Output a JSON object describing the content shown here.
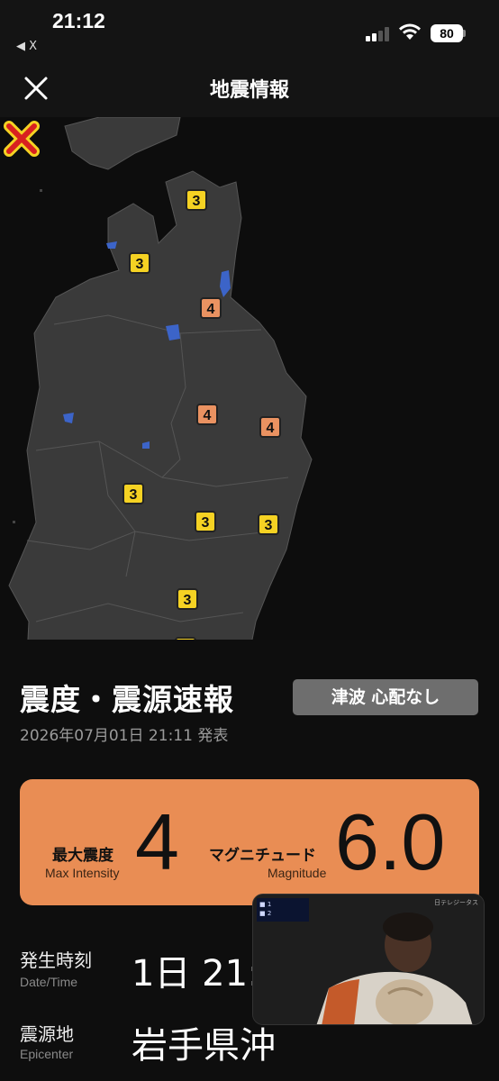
{
  "status_bar": {
    "time": "21:12",
    "back_label": "◀ X",
    "battery": "80"
  },
  "header": {
    "title": "地震情報",
    "close_icon": "close-icon"
  },
  "map": {
    "epicenter_icon": "epicenter-x-icon",
    "intensity_markers": [
      {
        "value": "3",
        "level": 3
      },
      {
        "value": "3",
        "level": 3
      },
      {
        "value": "4",
        "level": 4
      },
      {
        "value": "4",
        "level": 4
      },
      {
        "value": "4",
        "level": 4
      },
      {
        "value": "3",
        "level": 3
      },
      {
        "value": "3",
        "level": 3
      },
      {
        "value": "3",
        "level": 3
      },
      {
        "value": "3",
        "level": 3
      },
      {
        "value": "3",
        "level": 3
      }
    ],
    "colors": {
      "level3": "#f5d223",
      "level4": "#ea9261",
      "land": "#3a3a3a",
      "water": "#3c64c8"
    }
  },
  "report": {
    "title": "震度・震源速報",
    "tsunami_badge": "津波 心配なし",
    "issued": "2026年07月01日 21:11 発表"
  },
  "summary": {
    "max_intensity_label": "最大震度",
    "max_intensity_sub": "Max Intensity",
    "max_intensity_value": "4",
    "magnitude_label": "マグニチュード",
    "magnitude_sub": "Magnitude",
    "magnitude_value": "6.0",
    "card_color": "#e98d54"
  },
  "details": {
    "datetime_label": "発生時刻",
    "datetime_sub": "Date/Time",
    "datetime_value": "1日 21:",
    "epicenter_label": "震源地",
    "epicenter_sub": "Epicenter",
    "epicenter_value": "岩手県沖"
  },
  "pip": {
    "channel": "日テレジータス"
  }
}
